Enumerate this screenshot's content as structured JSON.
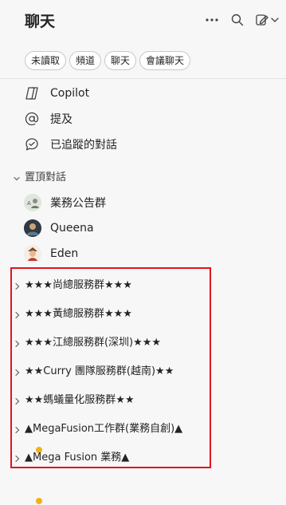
{
  "header": {
    "title": "聊天"
  },
  "filters": [
    "未讀取",
    "頻道",
    "聊天",
    "會議聊天"
  ],
  "quick_items": [
    {
      "icon": "copilot-icon",
      "label": "Copilot"
    },
    {
      "icon": "at-mention-icon",
      "label": "提及"
    },
    {
      "icon": "followed-chat-icon",
      "label": "已追蹤的對話"
    }
  ],
  "pinned_section": {
    "label": "置頂對話"
  },
  "pinned": [
    {
      "label": "業務公告群"
    },
    {
      "label": "Queena"
    },
    {
      "label": "Eden"
    }
  ],
  "groups": [
    {
      "label": "★★★尚總服務群★★★"
    },
    {
      "label": "★★★黃總服務群★★★"
    },
    {
      "label": "★★★江總服務群(深圳)★★★"
    },
    {
      "label": "★★Curry 團隊服務群(越南)★★"
    },
    {
      "label": "★★螞蟻量化服務群★★"
    },
    {
      "label": "▲MegaFusion工作群(業務自創)▲"
    },
    {
      "label": "▲Mega Fusion 業務▲"
    }
  ],
  "colors": {
    "highlight": "#e0141e",
    "status_away": "#f2b211"
  }
}
